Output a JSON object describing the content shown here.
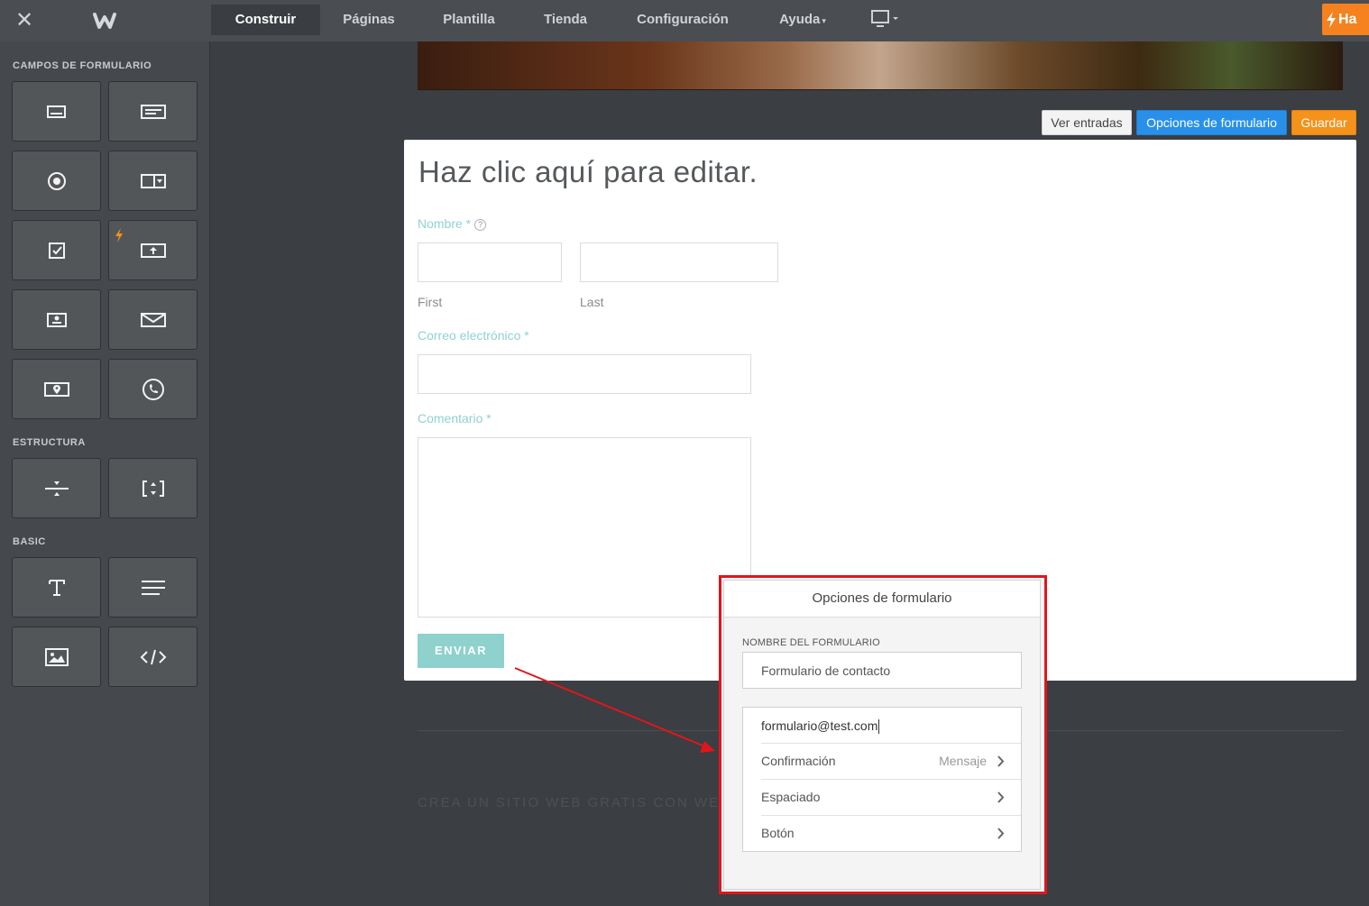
{
  "topbar": {
    "nav": [
      {
        "label": "Construir",
        "active": true
      },
      {
        "label": "Páginas",
        "active": false
      },
      {
        "label": "Plantilla",
        "active": false
      },
      {
        "label": "Tienda",
        "active": false
      },
      {
        "label": "Configuración",
        "active": false
      },
      {
        "label": "Ayuda",
        "active": false,
        "caret": "▾"
      }
    ],
    "upgrade_label": "Ha"
  },
  "sidebar": {
    "sections": [
      {
        "heading": "CAMPOS DE FORMULARIO",
        "icons": [
          "text-field-icon",
          "paragraph-field-icon",
          "radio-button-icon",
          "dropdown-icon",
          "checkbox-icon",
          "file-upload-icon",
          "name-field-icon",
          "email-icon",
          "address-icon",
          "phone-icon"
        ]
      },
      {
        "heading": "ESTRUCTURA",
        "icons": [
          "divider-icon",
          "spacer-icon"
        ]
      },
      {
        "heading": "BASIC",
        "icons": [
          "title-icon",
          "text-icon",
          "image-icon",
          "embed-code-icon"
        ]
      }
    ]
  },
  "toolbar": {
    "ver_entradas": "Ver entradas",
    "opciones": "Opciones de formulario",
    "guardar": "Guardar"
  },
  "form": {
    "title": "Haz clic aquí para editar.",
    "name_label": "Nombre *",
    "name_help": "?",
    "first_label": "First",
    "last_label": "Last",
    "email_label": "Correo electrónico *",
    "comment_label": "Comentario *",
    "submit_label": "ENVIAR"
  },
  "footer": {
    "text": "CREA UN SITIO WEB GRATIS CON WEEBLY"
  },
  "popup": {
    "title": "Opciones de formulario",
    "name_heading": "NOMBRE DEL FORMULARIO",
    "name_value": "Formulario de contacto",
    "email_value": "formulario@test.com",
    "rows": [
      {
        "label": "Confirmación",
        "value": "Mensaje"
      },
      {
        "label": "Espaciado",
        "value": ""
      },
      {
        "label": "Botón",
        "value": ""
      }
    ]
  },
  "colors": {
    "accent_blue": "#2990ea",
    "accent_orange": "#f5921b",
    "label_teal": "#8fd3cf",
    "highlight_red": "#e0161c"
  }
}
